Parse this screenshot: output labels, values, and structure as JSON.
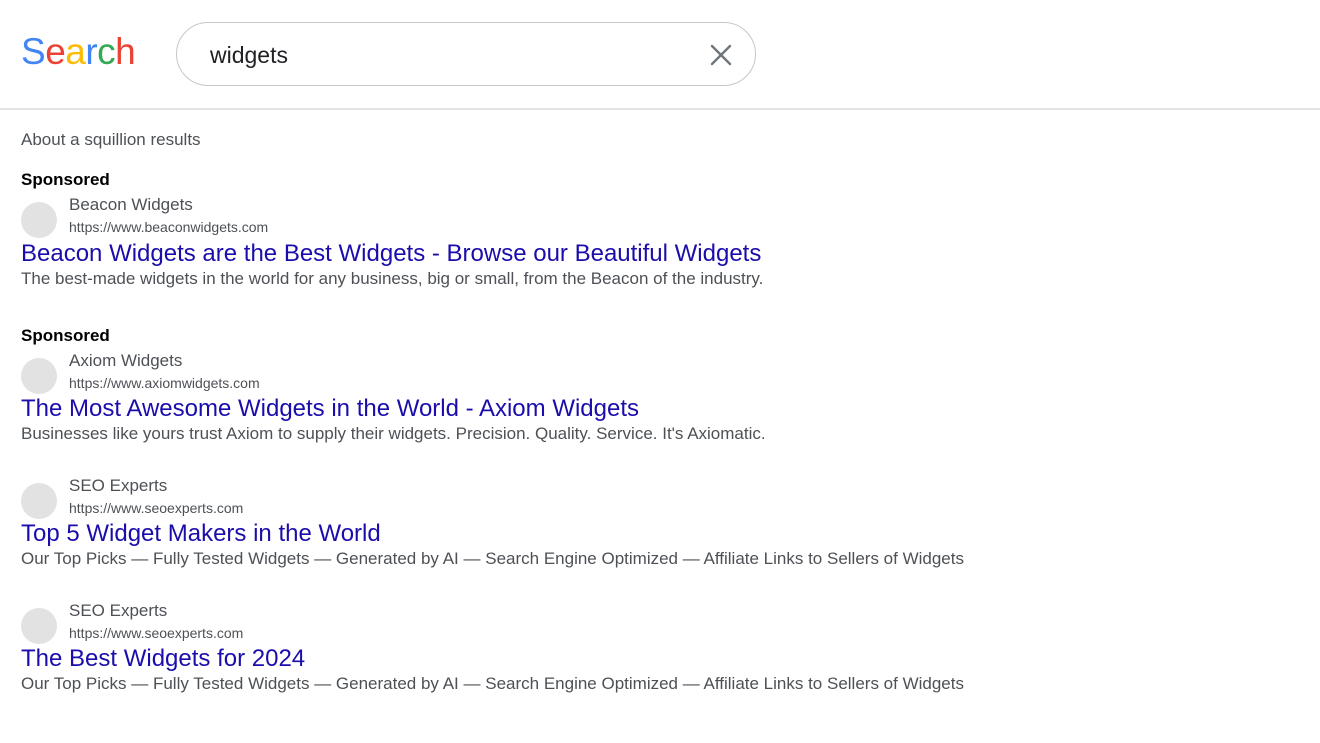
{
  "header": {
    "logo_letters": [
      {
        "char": "S",
        "color": "#4285f4"
      },
      {
        "char": "e",
        "color": "#ea4335"
      },
      {
        "char": "a",
        "color": "#fbbc05"
      },
      {
        "char": "r",
        "color": "#4285f4"
      },
      {
        "char": "c",
        "color": "#34a853"
      },
      {
        "char": "h",
        "color": "#ea4335"
      }
    ],
    "search_value": "widgets",
    "clear_icon": "close-icon"
  },
  "results_info": "About a squillion results",
  "results": [
    {
      "sponsored": "Sponsored",
      "site_name": "Beacon Widgets",
      "site_url": "https://www.beaconwidgets.com",
      "title": "Beacon Widgets are the Best Widgets - Browse our Beautiful Widgets",
      "snippet": "The best-made widgets in the world for any business, big or small, from the Beacon of the industry."
    },
    {
      "sponsored": "Sponsored",
      "site_name": "Axiom Widgets",
      "site_url": "https://www.axiomwidgets.com",
      "title": "The Most Awesome Widgets in the World - Axiom Widgets",
      "snippet": "Businesses like yours trust Axiom to supply their widgets. Precision. Quality. Service. It's Axiomatic."
    },
    {
      "sponsored": "",
      "site_name": "SEO Experts",
      "site_url": "https://www.seoexperts.com",
      "title": "Top 5 Widget Makers in the World",
      "snippet": "Our Top Picks — Fully Tested Widgets — Generated by AI — Search Engine Optimized — Affiliate Links to Sellers of Widgets"
    },
    {
      "sponsored": "",
      "site_name": "SEO Experts",
      "site_url": "https://www.seoexperts.com",
      "title": "The Best Widgets for 2024",
      "snippet": "Our Top Picks — Fully Tested Widgets — Generated by AI — Search Engine Optimized — Affiliate Links to Sellers of Widgets"
    }
  ],
  "colors": {
    "link": "#1a0dab",
    "text_secondary": "#4d5156",
    "favicon_placeholder": "#e2e2e2"
  }
}
